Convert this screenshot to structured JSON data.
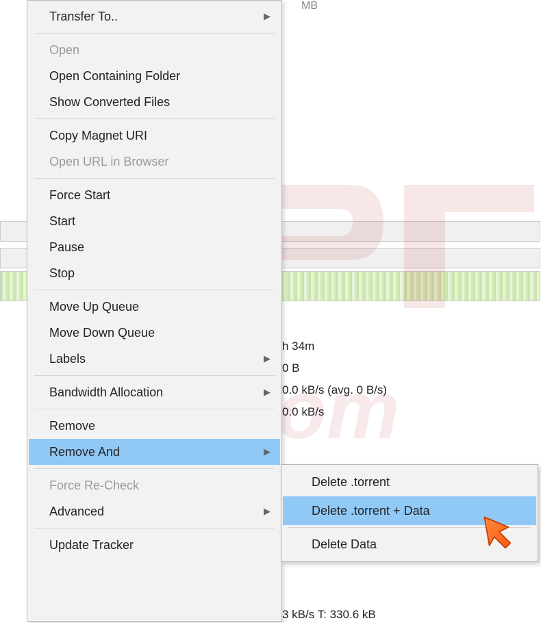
{
  "background": {
    "top_text": "MB",
    "info_lines": {
      "l1": "h 34m",
      "l2": "0 B",
      "l3": "0.0 kB/s (avg. 0 B/s)",
      "l4": "0.0 kB/s"
    },
    "bottom_text": "3 kB/s T: 330.6 kB"
  },
  "menu": {
    "transfer_to": "Transfer To..",
    "open": "Open",
    "open_containing": "Open Containing Folder",
    "show_converted": "Show Converted Files",
    "copy_magnet": "Copy Magnet URI",
    "open_url": "Open URL in Browser",
    "force_start": "Force Start",
    "start": "Start",
    "pause": "Pause",
    "stop": "Stop",
    "move_up": "Move Up Queue",
    "move_down": "Move Down Queue",
    "labels": "Labels",
    "bandwidth": "Bandwidth Allocation",
    "remove": "Remove",
    "remove_and": "Remove And",
    "force_recheck": "Force Re-Check",
    "advanced": "Advanced",
    "update_tracker": "Update Tracker"
  },
  "submenu": {
    "delete_torrent": "Delete .torrent",
    "delete_torrent_data": "Delete .torrent + Data",
    "delete_data": "Delete Data"
  }
}
